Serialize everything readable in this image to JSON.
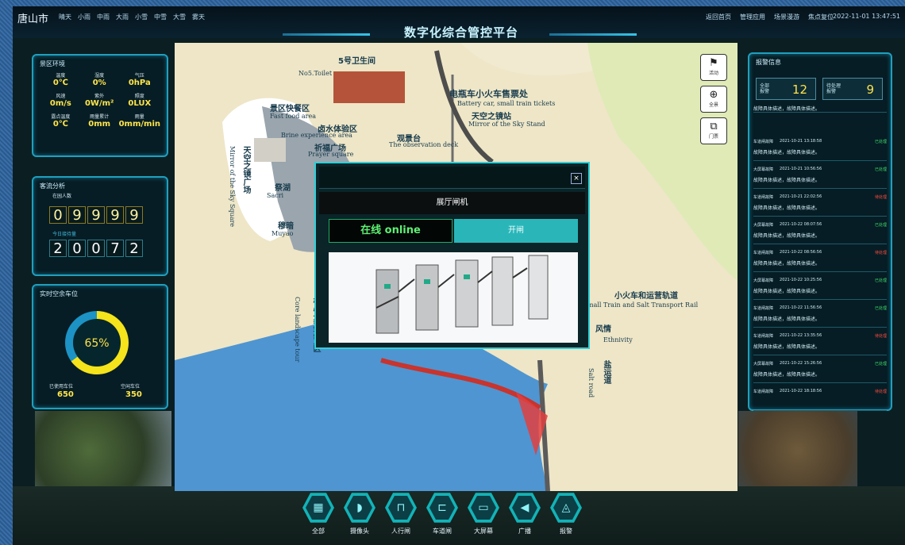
{
  "header": {
    "city": "唐山市",
    "weather": [
      "晴天",
      "小雨",
      "中雨",
      "大雨",
      "小雪",
      "中雪",
      "大雪",
      "雾天"
    ],
    "title": "数字化综合管控平台",
    "nav": [
      "返回首页",
      "管理应用",
      "场景漫游",
      "焦点复位"
    ],
    "datetime": "2022-11-01 13:47:51"
  },
  "env_panel": {
    "title": "景区环境",
    "items": [
      {
        "label": "温度",
        "value": "0℃"
      },
      {
        "label": "湿度",
        "value": "0%"
      },
      {
        "label": "气压",
        "value": "0hPa"
      },
      {
        "label": "风速",
        "value": "0m/s"
      },
      {
        "label": "紫外",
        "value": "0W/m²"
      },
      {
        "label": "照度",
        "value": "0LUX"
      },
      {
        "label": "露点温度",
        "value": "0℃"
      },
      {
        "label": "雨量累计",
        "value": "0mm"
      },
      {
        "label": "雨量",
        "value": "0mm/min"
      }
    ]
  },
  "flow_panel": {
    "title": "客流分析",
    "in_park_label": "在园人数",
    "in_park_digits": [
      "0",
      "9",
      "9",
      "9",
      "9"
    ],
    "today_label": "今日接待量",
    "today_digits": [
      "2",
      "0",
      "0",
      "7",
      "2"
    ]
  },
  "parking_panel": {
    "title": "实时空余车位",
    "percent": 65,
    "percent_text": "65%",
    "used_label": "已使用车位",
    "used_value": "650",
    "free_label": "空闲车位",
    "free_value": "350"
  },
  "map": {
    "labels": [
      {
        "text": "5号卫生间",
        "en": false
      },
      {
        "text": "No5.Toilet",
        "en": true
      },
      {
        "text": "电瓶车小火车售票处",
        "en": false
      },
      {
        "text": "Battery car, small train tickets",
        "en": true
      },
      {
        "text": "天空之镜站",
        "en": false
      },
      {
        "text": "Mirror of the Sky Stand",
        "en": true
      },
      {
        "text": "景区快餐区",
        "en": false
      },
      {
        "text": "Fast food area",
        "en": true
      },
      {
        "text": "卤水体验区",
        "en": false
      },
      {
        "text": "Brine experience area",
        "en": true
      },
      {
        "text": "观景台",
        "en": false
      },
      {
        "text": "The observation deck",
        "en": true
      },
      {
        "text": "祈福广场",
        "en": false
      },
      {
        "text": "Prayer square",
        "en": true
      },
      {
        "text": "天空之镜广场",
        "en": false
      },
      {
        "text": "Mirror of the Sky Square",
        "en": true
      },
      {
        "text": "祭湖",
        "en": false
      },
      {
        "text": "Sacri",
        "en": true
      },
      {
        "text": "穆暗",
        "en": false
      },
      {
        "text": "Muyao",
        "en": true
      },
      {
        "text": "小火车和运营轨道",
        "en": false
      },
      {
        "text": "mall Train and Salt Transport Rail",
        "en": true
      },
      {
        "text": "风情",
        "en": false
      },
      {
        "text": "Ethnivity",
        "en": true
      },
      {
        "text": "核心景观游览区",
        "en": false
      },
      {
        "text": "Core landscape tour",
        "en": true
      },
      {
        "text": "盐运道",
        "en": false
      },
      {
        "text": "Salt road",
        "en": true
      }
    ],
    "buttons": [
      {
        "icon": "flag-icon",
        "glyph": "⚑",
        "label": "活动"
      },
      {
        "icon": "globe-icon",
        "glyph": "⊕",
        "label": "全景"
      },
      {
        "icon": "gate-icon",
        "glyph": "⧉",
        "label": "门票"
      }
    ]
  },
  "modal": {
    "title": "展厅闸机",
    "close": "×",
    "status": "在线 online",
    "action": "开闸"
  },
  "alerts": {
    "title": "报警信息",
    "stat_all_label": "全部\n报警",
    "stat_all_value": "12",
    "stat_pending_label": "待处理\n报警",
    "stat_pending_value": "9",
    "rows": [
      {
        "type": "",
        "time": "",
        "status": "",
        "desc": "故障具体描述，故障具体描述。",
        "status_color": "#3fdc6a"
      },
      {
        "type": "车道闸故障",
        "time": "2021-10-21 13:18:58",
        "status": "已处理",
        "desc": "故障具体描述，故障具体描述。",
        "status_color": "#3fdc6a"
      },
      {
        "type": "大屏幕故障",
        "time": "2021-10-21 10:56:56",
        "status": "已处理",
        "desc": "故障具体描述，故障具体描述。",
        "status_color": "#3fdc6a"
      },
      {
        "type": "车道闸故障",
        "time": "2021-10-21 22:02:56",
        "status": "待处理",
        "desc": "故障具体描述，故障具体描述。",
        "status_color": "#ff4b3e"
      },
      {
        "type": "大屏幕故障",
        "time": "2021-10-22 08:07:56",
        "status": "已处理",
        "desc": "故障具体描述，故障具体描述。",
        "status_color": "#3fdc6a"
      },
      {
        "type": "车道闸故障",
        "time": "2021-10-22 08:56:56",
        "status": "待处理",
        "desc": "故障具体描述，故障具体描述。",
        "status_color": "#ff4b3e"
      },
      {
        "type": "大屏幕故障",
        "time": "2021-10-22 10:25:56",
        "status": "已处理",
        "desc": "故障具体描述，故障具体描述。",
        "status_color": "#3fdc6a"
      },
      {
        "type": "车道闸故障",
        "time": "2021-10-22 11:56:56",
        "status": "已处理",
        "desc": "故障具体描述，故障具体描述。",
        "status_color": "#3fdc6a"
      },
      {
        "type": "车道闸故障",
        "time": "2021-10-22 13:35:56",
        "status": "待处理",
        "desc": "故障具体描述，故障具体描述。",
        "status_color": "#ff4b3e"
      },
      {
        "type": "大屏幕故障",
        "time": "2021-10-22 15:26:56",
        "status": "已处理",
        "desc": "故障具体描述，故障具体描述。",
        "status_color": "#3fdc6a"
      },
      {
        "type": "车道闸故障",
        "time": "2021-10-22 18:18:56",
        "status": "待处理",
        "desc": "",
        "status_color": "#ff4b3e"
      }
    ]
  },
  "dock": [
    {
      "label": "全部",
      "icon": "grid-icon",
      "glyph": "▦"
    },
    {
      "label": "摄像头",
      "icon": "camera-icon",
      "glyph": "◗"
    },
    {
      "label": "人行闸",
      "icon": "pedestrian-gate-icon",
      "glyph": "⊓"
    },
    {
      "label": "车道闸",
      "icon": "vehicle-gate-icon",
      "glyph": "⊏"
    },
    {
      "label": "大屏幕",
      "icon": "screen-icon",
      "glyph": "▭"
    },
    {
      "label": "广播",
      "icon": "speaker-icon",
      "glyph": "◀"
    },
    {
      "label": "报警",
      "icon": "alarm-icon",
      "glyph": "◬"
    }
  ],
  "colors": {
    "accent": "#1f9fbe",
    "value_yellow": "#ffe54a",
    "online_green": "#5ef073",
    "open_teal": "#2ab6b9"
  }
}
